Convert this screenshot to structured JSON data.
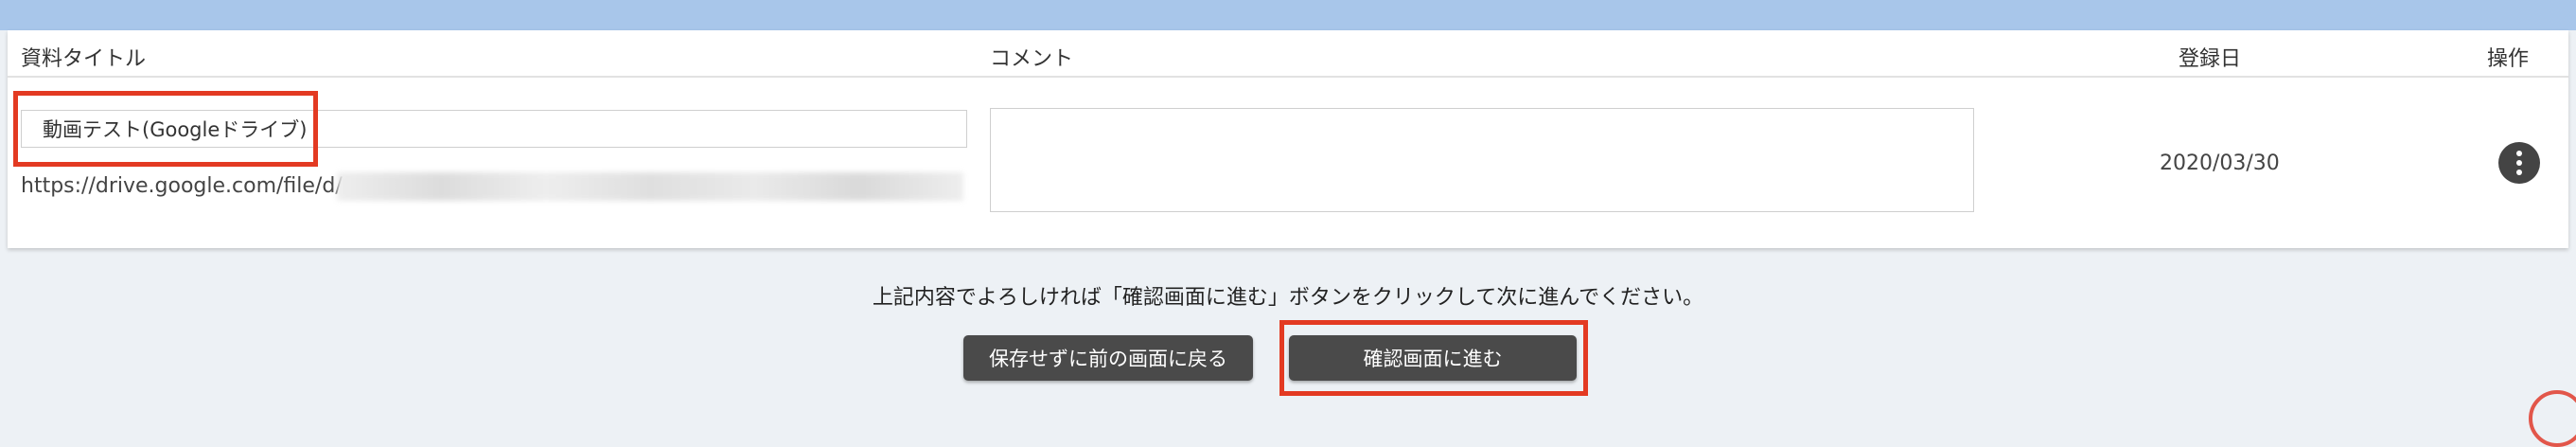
{
  "table": {
    "headers": {
      "title": "資料タイトル",
      "comment": "コメント",
      "date": "登録日",
      "actions": "操作"
    },
    "row": {
      "title_value": "動画テスト(Googleドライブ)",
      "url_prefix": "https://drive.google.com/file/d/",
      "comment_value": "",
      "date": "2020/03/30"
    }
  },
  "footer": {
    "instruction": "上記内容でよろしければ「確認画面に進む」ボタンをクリックして次に進んでください。",
    "back_label": "保存せずに前の画面に戻る",
    "confirm_label": "確認画面に進む"
  },
  "colors": {
    "header_bar": "#a8c6ea",
    "background": "#edf1f5",
    "button": "#4a4a4a",
    "highlight": "#e33a22"
  },
  "icons": {
    "actions": "more-vertical-icon"
  }
}
